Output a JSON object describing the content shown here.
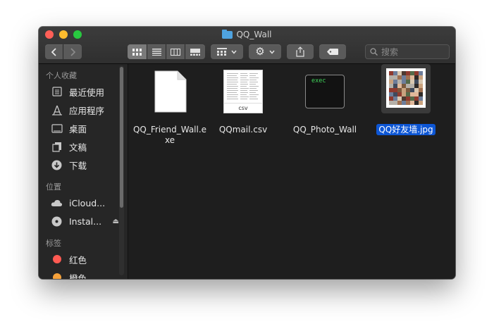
{
  "window": {
    "title": "QQ_Wall"
  },
  "toolbar": {
    "view_buttons": [
      "icon-view",
      "list-view",
      "column-view",
      "gallery-view"
    ],
    "search_placeholder": "搜索"
  },
  "sidebar": {
    "sections": [
      {
        "header": "个人收藏",
        "items": [
          {
            "label": "最近使用",
            "icon": "clock-icon"
          },
          {
            "label": "应用程序",
            "icon": "applications-icon"
          },
          {
            "label": "桌面",
            "icon": "desktop-icon"
          },
          {
            "label": "文稿",
            "icon": "document-icon"
          },
          {
            "label": "下载",
            "icon": "download-icon"
          }
        ]
      },
      {
        "header": "位置",
        "items": [
          {
            "label": "iCloud...",
            "icon": "cloud-icon"
          },
          {
            "label": "Instal...",
            "icon": "disk-icon"
          }
        ]
      },
      {
        "header": "标签",
        "items": [
          {
            "label": "红色",
            "color": "#ff5a52"
          },
          {
            "label": "橙色",
            "color": "#f6a23b"
          }
        ]
      }
    ]
  },
  "files": [
    {
      "name": "QQ_Friend_Wall.exe",
      "type": "blank-document"
    },
    {
      "name": "QQmail.csv",
      "type": "csv",
      "badge": "csv"
    },
    {
      "name": "QQ_Photo_Wall",
      "type": "exec",
      "badge": "exec"
    },
    {
      "name": "QQ好友墙.jpg",
      "type": "image",
      "selected": true
    }
  ],
  "colors": {
    "selection": "#0d56d4",
    "exec_text": "#3fd35a"
  }
}
